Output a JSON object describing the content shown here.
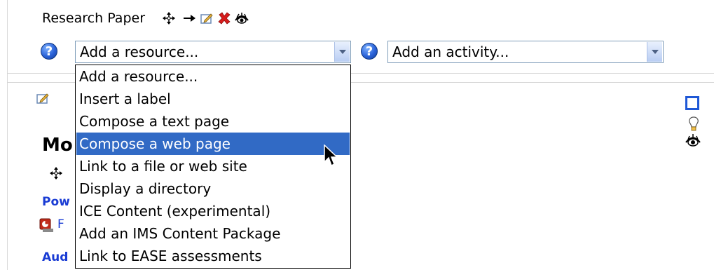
{
  "section": {
    "title": "Research Paper",
    "heading_partial": "Mo",
    "links_partial": [
      "Pow",
      "Aud"
    ],
    "file_link_partial": "F"
  },
  "resource_select": {
    "help_icon": "help-question-icon",
    "selected": "Add a resource...",
    "options": [
      "Add a resource...",
      "Insert a label",
      "Compose a text page",
      "Compose a web page",
      "Link to a file or web site",
      "Display a directory",
      "ICE Content (experimental)",
      "Add an IMS Content Package",
      "Link to EASE assessments"
    ],
    "highlighted": "Compose a web page"
  },
  "activity_select": {
    "help_icon": "help-question-icon",
    "selected": "Add an activity..."
  },
  "icons": {
    "header": [
      "move-icon",
      "arrow-right-icon",
      "edit-icon",
      "delete-icon",
      "eye-icon"
    ],
    "right": [
      "one-column-icon",
      "lightbulb-icon",
      "eye-icon"
    ]
  },
  "colors": {
    "highlight": "#316ac5",
    "link": "#1a3cd4",
    "help": "#2a62d8",
    "delete": "#d81c1c"
  }
}
